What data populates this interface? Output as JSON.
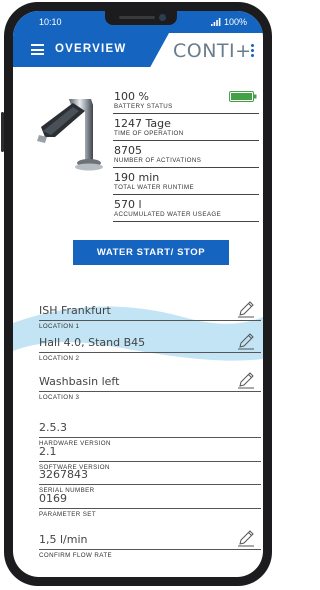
{
  "status_bar": {
    "time": "10:10",
    "battery": "100%"
  },
  "app_bar": {
    "title": "OVERVIEW",
    "logo": "CONTI+"
  },
  "stats": [
    {
      "value": "100 %",
      "label": "BATTERY STATUS"
    },
    {
      "value": "1247 Tage",
      "label": "TIME OF OPERATION"
    },
    {
      "value": "8705",
      "label": "NUMBER OF ACTIVATIONS"
    },
    {
      "value": "190 min",
      "label": "TOTAL WATER RUNTIME"
    },
    {
      "value": "570 l",
      "label": "ACCUMULATED WATER USEAGE"
    }
  ],
  "water_button": {
    "label": "WATER START/ STOP"
  },
  "fields": [
    {
      "value": "ISH Frankfurt",
      "label": "LOCATION 1",
      "editable": true
    },
    {
      "value": "Hall 4.0, Stand B45",
      "label": "LOCATION 2",
      "editable": true
    },
    {
      "value": "Washbasin left",
      "label": "LOCATION 3",
      "editable": true
    },
    {
      "value": "2.5.3",
      "label": "HARDWARE VERSION",
      "editable": false
    },
    {
      "value": "2.1",
      "label": "SOFTWARE VERSION",
      "editable": false
    },
    {
      "value": "3267843",
      "label": "SERIAL NUMBER",
      "editable": false
    },
    {
      "value": "0169",
      "label": "PARAMETER SET",
      "editable": false
    },
    {
      "value": "1,5 l/min",
      "label": "CONFIRM FLOW RATE",
      "editable": true
    }
  ],
  "icons": {
    "menu": "menu-icon",
    "more": "kebab-icon",
    "battery": "battery-icon",
    "edit": "pencil-icon",
    "product": "faucet-image"
  },
  "colors": {
    "primary": "#1565c0",
    "battery_fill": "#43a047",
    "wave": "#b9dff2"
  }
}
